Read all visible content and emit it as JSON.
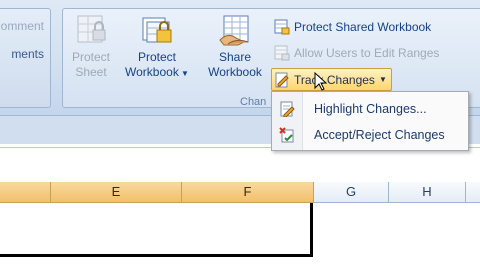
{
  "ribbon": {
    "left_group": {
      "item1": "omment",
      "item2": "ments"
    },
    "changes_group": {
      "label": "Chan",
      "protect_sheet": {
        "line1": "Protect",
        "line2": "Sheet"
      },
      "protect_workbook": {
        "line1": "Protect",
        "line2": "Workbook"
      },
      "share_workbook": {
        "line1": "Share",
        "line2": "Workbook"
      },
      "protect_shared": "Protect Shared Workbook",
      "allow_users": "Allow Users to Edit Ranges",
      "track_changes": "Track Changes"
    }
  },
  "menu": {
    "highlight": "Highlight Changes...",
    "accept_reject": "Accept/Reject Changes"
  },
  "columns": [
    "E",
    "F",
    "G",
    "H"
  ],
  "colors": {
    "selected_header": "#f2c06a",
    "ribbon": "#d1dff0"
  }
}
